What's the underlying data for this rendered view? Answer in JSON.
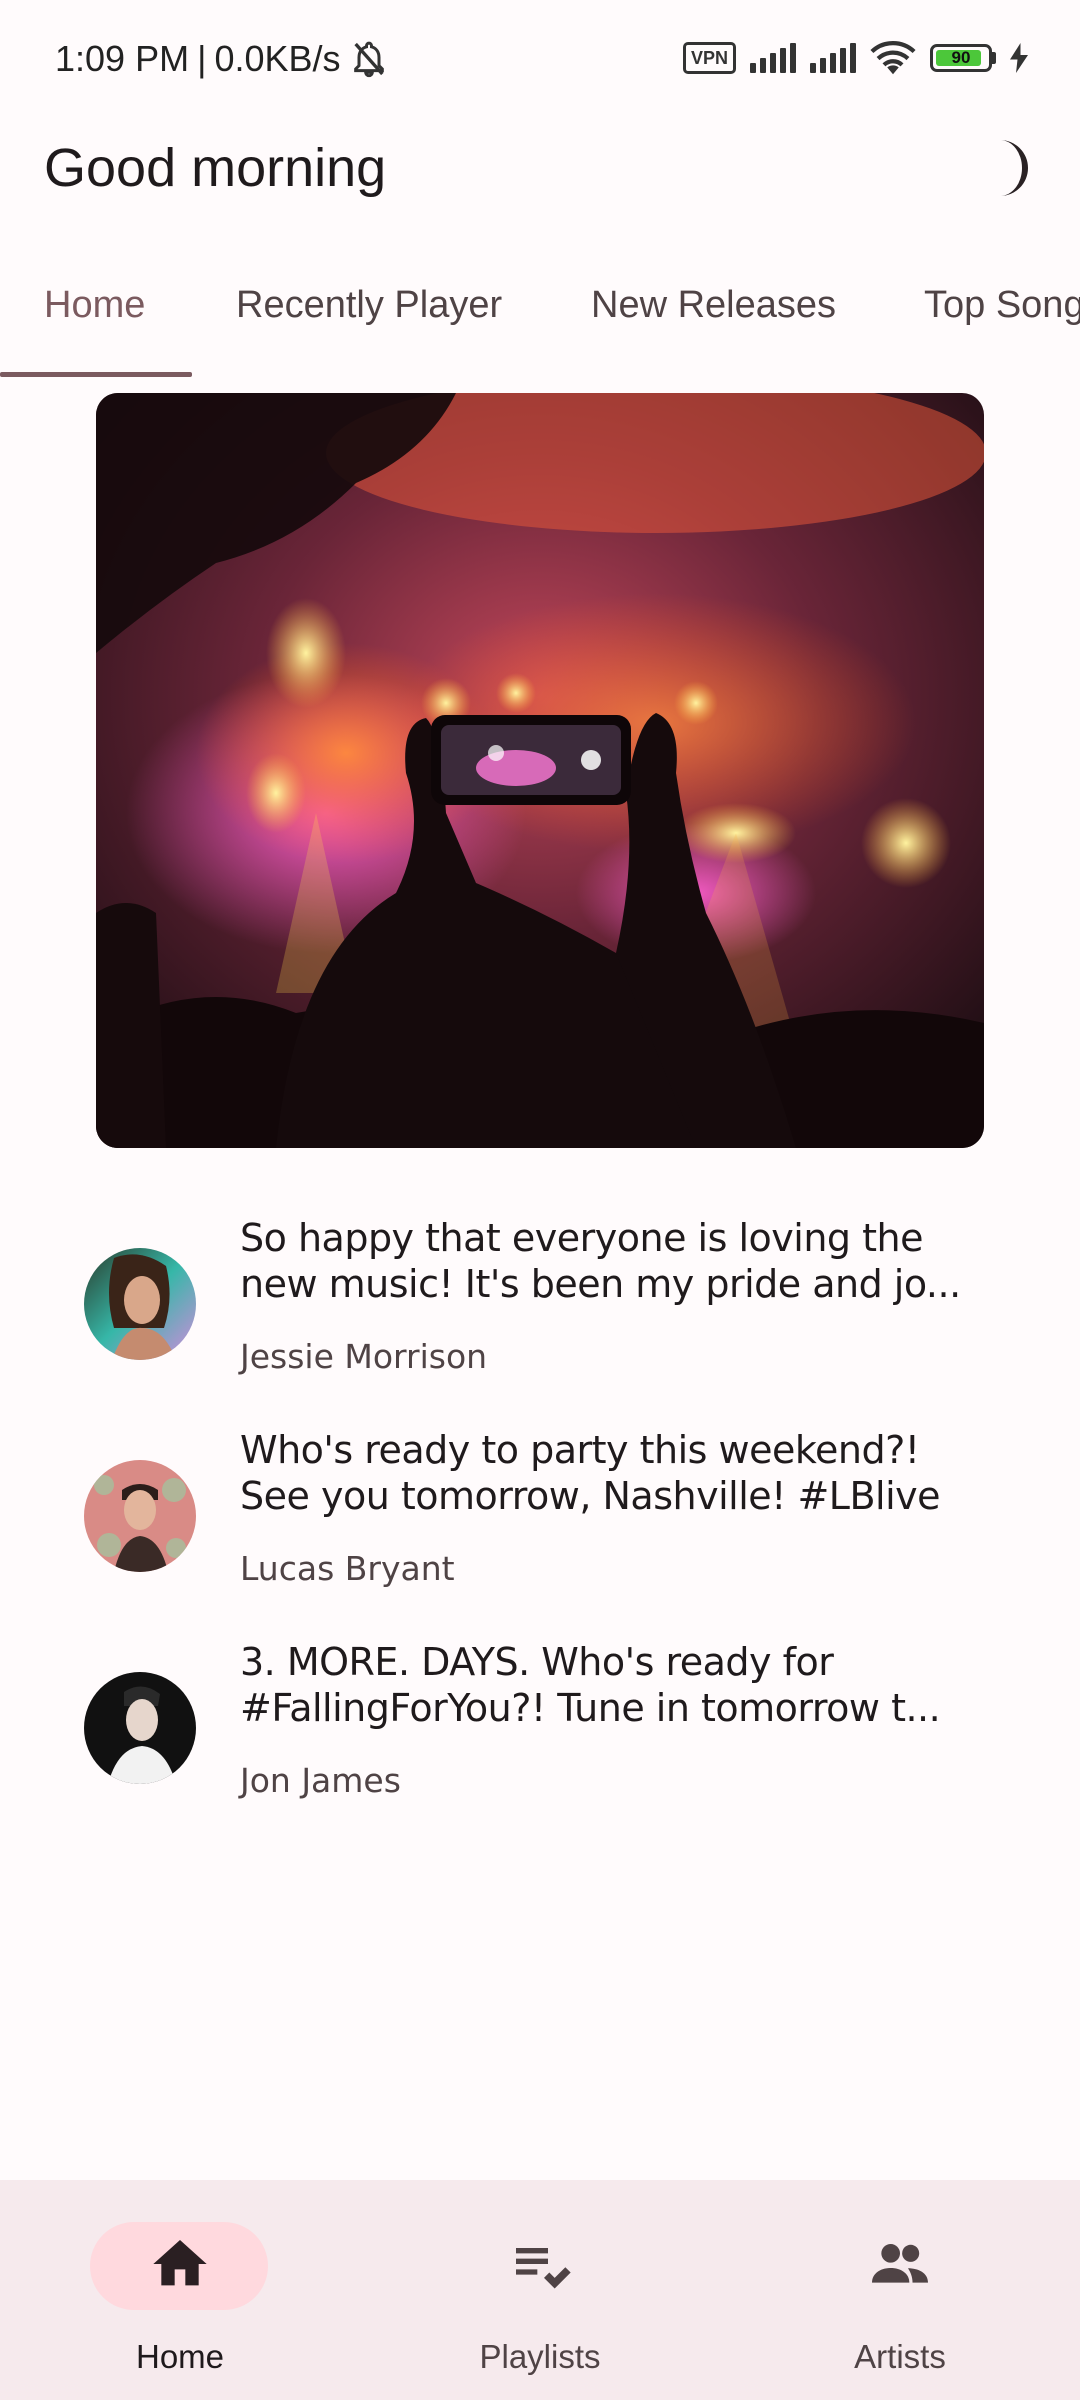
{
  "status_bar": {
    "time": "1:09 PM",
    "separator": "|",
    "network_speed": "0.0KB/s",
    "vpn_label": "VPN",
    "battery_level": "90",
    "battery_fraction": 0.9
  },
  "header": {
    "greeting": "Good morning"
  },
  "tabs": [
    {
      "label": "Home",
      "active": true
    },
    {
      "label": "Recently Player",
      "active": false
    },
    {
      "label": "New Releases",
      "active": false
    },
    {
      "label": "Top Songs",
      "active": false
    }
  ],
  "feed": [
    {
      "text_line1": "So happy that everyone is loving the",
      "text_line2": "new music! It's been my pride and jo...",
      "author": "Jessie Morrison"
    },
    {
      "text_line1": "Who's ready to party this weekend?!",
      "text_line2": "See you tomorrow, Nashville! #LBlive",
      "author": "Lucas Bryant"
    },
    {
      "text_line1": "3. MORE. DAYS. Who's ready for",
      "text_line2": "#FallingForYou?! Tune in tomorrow t...",
      "author": "Jon James"
    }
  ],
  "bottom_nav": [
    {
      "label": "Home",
      "icon": "home-icon",
      "active": true
    },
    {
      "label": "Playlists",
      "icon": "playlist-check-icon",
      "active": false
    },
    {
      "label": "Artists",
      "icon": "people-icon",
      "active": false
    }
  ],
  "colors": {
    "background": "#fffbfc",
    "accent": "#7b5a5f",
    "nav_background": "#f6eaed",
    "nav_active_pill": "#ffd9de"
  }
}
